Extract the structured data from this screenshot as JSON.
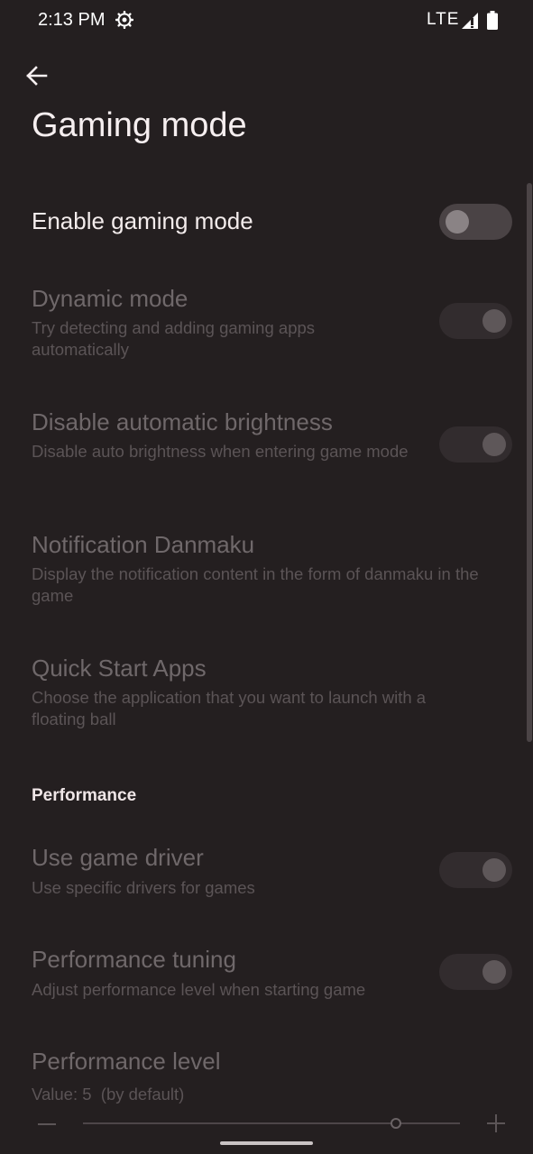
{
  "status_bar": {
    "time": "2:13 PM",
    "network": "LTE",
    "icons": [
      "settings-gear-icon",
      "signal-icon",
      "battery-icon"
    ]
  },
  "header": {
    "title": "Gaming mode",
    "back_icon": "arrow-back-icon"
  },
  "settings": {
    "enable_gaming_mode": {
      "title": "Enable gaming mode",
      "toggle": "off"
    },
    "dynamic_mode": {
      "title": "Dynamic mode",
      "summary": "Try detecting and adding gaming apps automatically",
      "toggle": "on-disabled"
    },
    "disable_auto_brightness": {
      "title": "Disable automatic brightness",
      "summary": "Disable auto brightness when entering game mode",
      "toggle": "on-disabled"
    },
    "notification_danmaku": {
      "title": "Notification Danmaku",
      "summary": "Display the notification content in the form of danmaku in the game"
    },
    "quick_start_apps": {
      "title": "Quick Start Apps",
      "summary": "Choose the application that you want to launch with a floating ball"
    }
  },
  "performance": {
    "section_title": "Performance",
    "use_game_driver": {
      "title": "Use game driver",
      "summary": "Use specific drivers for games",
      "toggle": "on-disabled"
    },
    "performance_tuning": {
      "title": "Performance tuning",
      "summary": "Adjust performance level when starting game",
      "toggle": "on-disabled"
    },
    "performance_level": {
      "title": "Performance level",
      "summary": "Value: 5  (by default)",
      "slider_value_fraction": 0.83
    }
  },
  "colors": {
    "background": "#241f20",
    "text_enabled": "#f3ecec",
    "text_disabled": "#6f686a"
  }
}
